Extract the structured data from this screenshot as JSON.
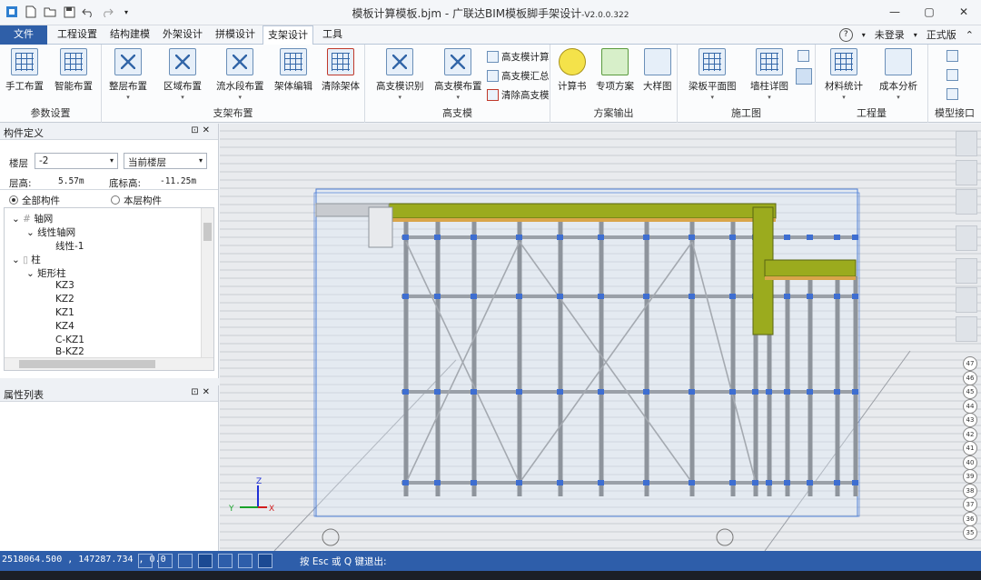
{
  "window": {
    "title": "模板计算模板.bjm - 广联达BIM模板脚手架设计",
    "version": "-V2.0.0.322"
  },
  "tabs": [
    "文件",
    "工程设置",
    "结构建模",
    "外架设计",
    "拼模设计",
    "支架设计",
    "工具"
  ],
  "active_tab": "支架设计",
  "tabs_right": {
    "help": "?",
    "login": "未登录",
    "edition": "正式版"
  },
  "ribbon": {
    "groups": [
      {
        "label": "参数设置",
        "buttons": [
          "手工布置",
          "智能布置"
        ]
      },
      {
        "label": "支架布置",
        "buttons": [
          "整层布置",
          "区域布置",
          "流水段布置",
          "架体编辑",
          "清除架体"
        ]
      },
      {
        "label": "高支模",
        "buttons": [
          "高支模识别",
          "高支模布置"
        ],
        "small": [
          "高支模计算",
          "高支模汇总",
          "清除高支模"
        ]
      },
      {
        "label": "方案输出",
        "buttons": [
          "计算书",
          "专项方案",
          "大样图"
        ]
      },
      {
        "label": "施工图",
        "buttons": [
          "梁板平面图",
          "墙柱详图"
        ]
      },
      {
        "label": "工程量",
        "buttons": [
          "材料统计",
          "成本分析"
        ]
      },
      {
        "label": "模型接口",
        "buttons": []
      }
    ]
  },
  "component_panel": {
    "title": "构件定义",
    "floor_label": "楼层",
    "floor_value": "-2",
    "scope_value": "当前楼层",
    "height_label": "层高:",
    "height_value": "5.57m",
    "bottom_label": "底标高:",
    "bottom_value": "-11.25m",
    "radio_all": "全部构件",
    "radio_floor": "本层构件",
    "tree": [
      "轴网",
      "线性轴网",
      "线性-1",
      "柱",
      "矩形柱",
      "KZ3",
      "KZ2",
      "KZ1",
      "KZ4",
      "C-KZ1",
      "B-KZ2"
    ]
  },
  "property_panel": {
    "title": "属性列表"
  },
  "floor_indicators": [
    "47",
    "46",
    "45",
    "44",
    "43",
    "42",
    "41",
    "40",
    "39",
    "38",
    "37",
    "36",
    "35"
  ],
  "axis": {
    "z": "Z",
    "y": "Y",
    "x": "X"
  },
  "status": {
    "coords": "2518064.500 , 147287.734 , 0.0",
    "hint": "按 Esc 或 Q 键退出:"
  }
}
